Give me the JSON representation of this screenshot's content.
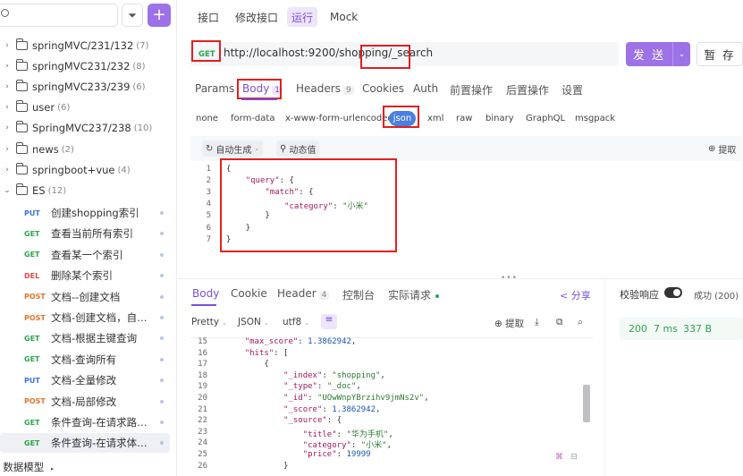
{
  "sidebar": {
    "filter_icon": "filter-icon",
    "add_icon": "plus-icon",
    "folders": [
      {
        "name": "springMVC/231/132",
        "count": "(7)"
      },
      {
        "name": "springMVC231/232",
        "count": "(8)"
      },
      {
        "name": "springMVC233/239",
        "count": "(6)"
      },
      {
        "name": "user",
        "count": "(6)"
      },
      {
        "name": "SpringMVC237/238",
        "count": "(10)"
      },
      {
        "name": "news",
        "count": "(2)"
      },
      {
        "name": "springboot+vue",
        "count": "(4)"
      },
      {
        "name": "ES",
        "count": "(12)"
      }
    ],
    "apis": [
      {
        "method": "PUT",
        "title": "创建shopping索引"
      },
      {
        "method": "GET",
        "title": "查看当前所有索引"
      },
      {
        "method": "GET",
        "title": "查看某一个索引"
      },
      {
        "method": "DEL",
        "title": "删除某个索引"
      },
      {
        "method": "POST",
        "title": "文档--创建文档"
      },
      {
        "method": "POST",
        "title": "文档-创建文档，自定..."
      },
      {
        "method": "GET",
        "title": "文档-根据主键查询"
      },
      {
        "method": "GET",
        "title": "文档-查询所有"
      },
      {
        "method": "PUT",
        "title": "文档-全量修改"
      },
      {
        "method": "POST",
        "title": "文档-局部修改"
      },
      {
        "method": "GET",
        "title": "条件查询-在请求路径..."
      },
      {
        "method": "GET",
        "title": "条件查询-在请求体中..."
      }
    ],
    "footer": "数据模型"
  },
  "top_tabs": [
    "接口",
    "修改接口",
    "运行",
    "Mock"
  ],
  "request": {
    "method": "GET",
    "url": "http://localhost:9200/shopping/_search",
    "send_label": "发 送",
    "save_label": "暂 存"
  },
  "req_tabs": [
    {
      "label": "Params"
    },
    {
      "label": "Body",
      "badge": "1"
    },
    {
      "label": "Headers",
      "badge": "9"
    },
    {
      "label": "Cookies"
    },
    {
      "label": "Auth"
    },
    {
      "label": "前置操作"
    },
    {
      "label": "后置操作"
    },
    {
      "label": "设置"
    }
  ],
  "body_types": [
    "none",
    "form-data",
    "x-www-form-urlencoded",
    "json",
    "xml",
    "raw",
    "binary",
    "GraphQL",
    "msgpack"
  ],
  "editor_toolbar": {
    "auto_gen": "自动生成",
    "dynamic": "动态值",
    "extract": "提取"
  },
  "request_body": {
    "line_numbers": [
      "1",
      "2",
      "3",
      "4",
      "5",
      "6",
      "7"
    ],
    "lines": [
      "{",
      "    \"query\": {",
      "        \"match\": {",
      "            \"category\": \"小米\"",
      "        }",
      "    }",
      "}"
    ]
  },
  "resp_tabs": [
    {
      "label": "Body"
    },
    {
      "label": "Cookie"
    },
    {
      "label": "Header",
      "badge": "4"
    },
    {
      "label": "控制台"
    },
    {
      "label": "实际请求"
    }
  ],
  "share_label": "分享",
  "resp_options": {
    "pretty": "Pretty",
    "format": "JSON",
    "encoding": "utf8",
    "extract": "提取"
  },
  "response_body": {
    "line_numbers": [
      "15",
      "16",
      "17",
      "18",
      "19",
      "20",
      "21",
      "22",
      "23",
      "24",
      "25",
      "26"
    ],
    "lines": [
      "    \"max_score\": 1.3862942,",
      "    \"hits\": [",
      "        {",
      "            \"_index\": \"shopping\",",
      "            \"_type\": \"_doc\",",
      "            \"_id\": \"UOwWnpYBrzihv9jmNs2v\",",
      "            \"_score\": 1.3862942,",
      "            \"_source\": {",
      "                \"title\": \"华为手机\",",
      "                \"category\": \"小米\",",
      "                \"price\": 19999",
      "            }"
    ]
  },
  "validation": {
    "label": "校验响应",
    "status": "成功 (200)",
    "code": "200",
    "time": "7 ms",
    "size": "337 B"
  },
  "colors": {
    "accent": "#9c72e6",
    "get": "#2ba54e",
    "post": "#e0752b",
    "put": "#3b74d8",
    "del": "#e04848",
    "annotation": "#e02020"
  }
}
